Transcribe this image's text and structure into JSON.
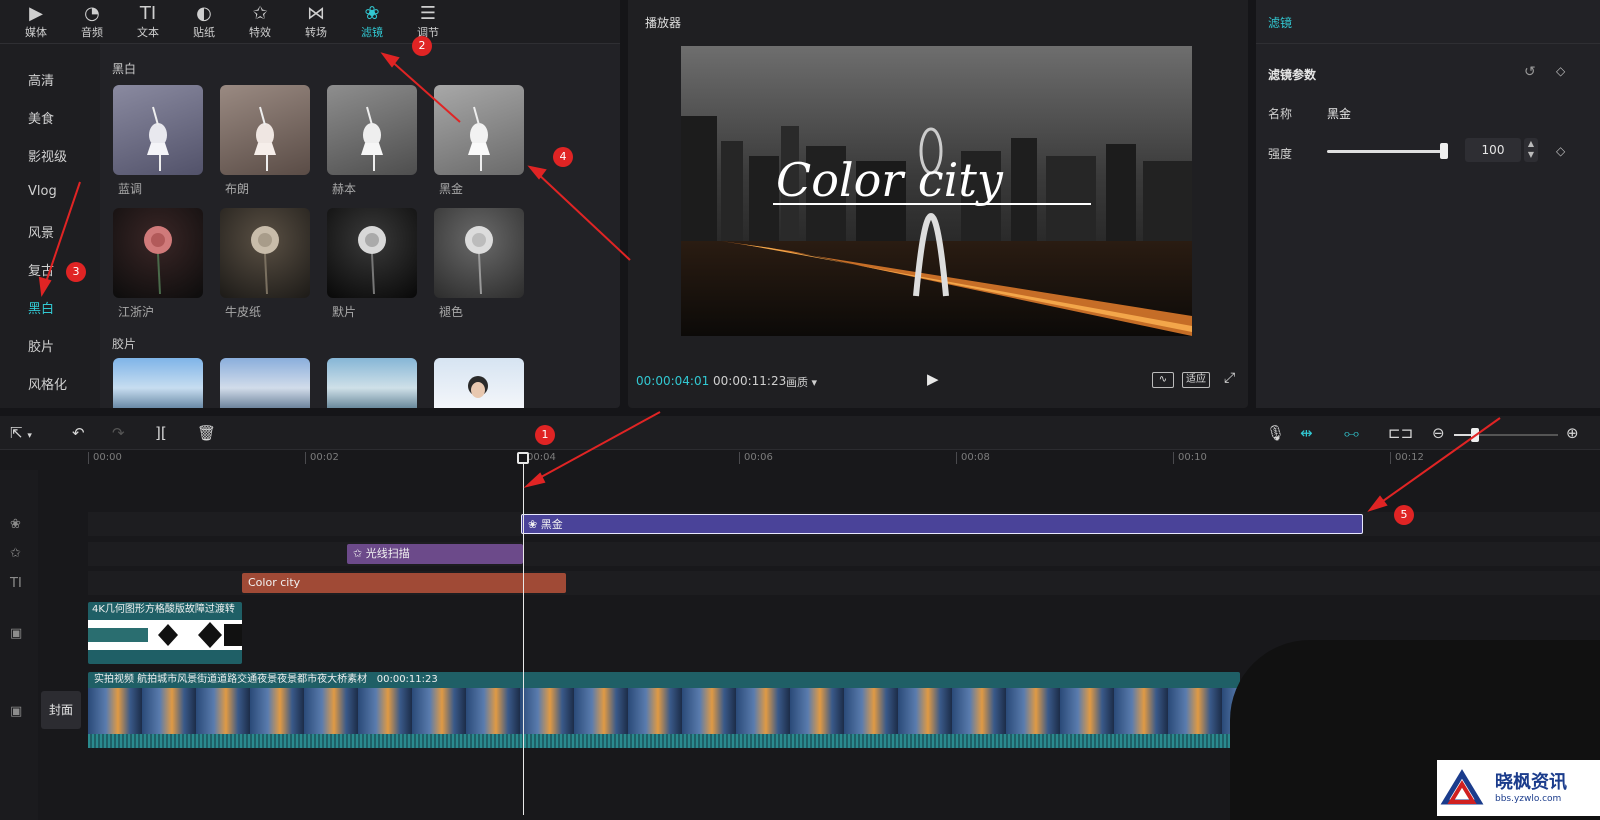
{
  "top_tabs": [
    {
      "label": "媒体",
      "icon": "media-icon"
    },
    {
      "label": "音频",
      "icon": "audio-icon"
    },
    {
      "label": "文本",
      "icon": "text-icon"
    },
    {
      "label": "贴纸",
      "icon": "sticker-icon"
    },
    {
      "label": "特效",
      "icon": "effects-icon"
    },
    {
      "label": "转场",
      "icon": "transition-icon"
    },
    {
      "label": "滤镜",
      "icon": "filter-icon",
      "active": true
    },
    {
      "label": "调节",
      "icon": "adjust-icon"
    }
  ],
  "categories": [
    "高清",
    "美食",
    "影视级",
    "Vlog",
    "风景",
    "复古",
    "黑白",
    "胶片",
    "风格化"
  ],
  "active_category": "黑白",
  "group_bw": {
    "title": "黑白",
    "row1": [
      "蓝调",
      "布朗",
      "赫本",
      "黑金"
    ],
    "row2": [
      "江浙沪",
      "牛皮纸",
      "默片",
      "褪色"
    ]
  },
  "group_film": {
    "title": "胶片"
  },
  "player": {
    "title": "播放器",
    "video_text": "Color city",
    "current_time": "00:00:04:01",
    "total_time": "00:00:11:23",
    "quality": "画质",
    "fit_label": "适应"
  },
  "inspector": {
    "title": "滤镜",
    "section": "滤镜参数",
    "name_label": "名称",
    "name_value": "黑金",
    "strength_label": "强度",
    "strength_value": "100",
    "strength_fraction": 1.0
  },
  "timeline": {
    "ticks": [
      "00:00",
      "00:02",
      "00:04",
      "00:06",
      "00:08",
      "00:10",
      "00:12"
    ],
    "filter_clip": "黑金",
    "effect_clip": "光线扫描",
    "text_clip": "Color city",
    "overlay_clip": "4K几何图形方格酸版故障过渡转",
    "main_clip": "实拍视频 航拍城市风景街道道路交通夜景夜景都市夜大桥素材",
    "main_clip_duration": "00:00:11:23",
    "cover_label": "封面",
    "zoom_fraction": 0.2
  },
  "badges": [
    "1",
    "2",
    "3",
    "4",
    "5"
  ],
  "colors": {
    "accent": "#32c8d2",
    "filter_clip": "#4a4399",
    "effect_clip": "#6c4a8a",
    "text_clip": "#a04a36",
    "video_clip": "#1f5f66",
    "annotation": "#e02424"
  },
  "watermark": {
    "text": "晓枫资讯",
    "url": "bbs.yzwlo.com"
  }
}
